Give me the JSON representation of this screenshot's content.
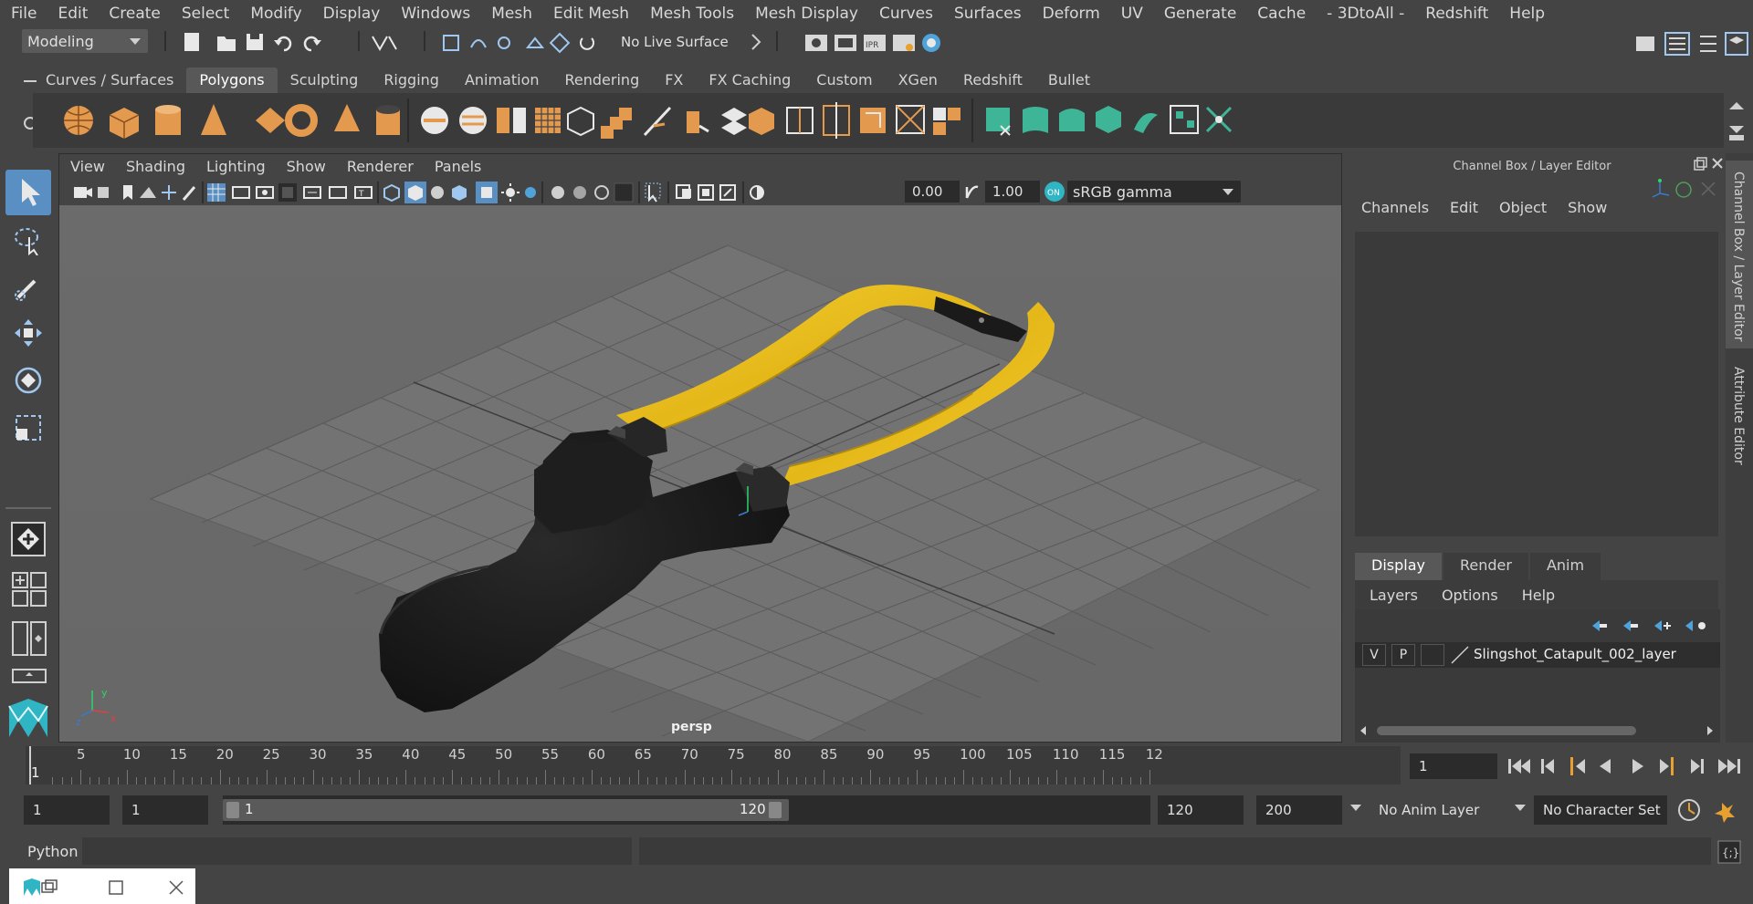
{
  "menubar": {
    "items": [
      "File",
      "Edit",
      "Create",
      "Select",
      "Modify",
      "Display",
      "Windows",
      "Mesh",
      "Edit Mesh",
      "Mesh Tools",
      "Mesh Display",
      "Curves",
      "Surfaces",
      "Deform",
      "UV",
      "Generate",
      "Cache",
      "- 3DtoAll -",
      "Redshift",
      "Help"
    ]
  },
  "statusline": {
    "mode": "Modeling",
    "live_surface": "No Live Surface"
  },
  "shelf": {
    "tabs": [
      "Curves / Surfaces",
      "Polygons",
      "Sculpting",
      "Rigging",
      "Animation",
      "Rendering",
      "FX",
      "FX Caching",
      "Custom",
      "XGen",
      "Redshift",
      "Bullet"
    ],
    "active_tab": "Polygons"
  },
  "viewport": {
    "menu": [
      "View",
      "Shading",
      "Lighting",
      "Show",
      "Renderer",
      "Panels"
    ],
    "exposure": "0.00",
    "gamma": "1.00",
    "colorspace": "sRGB gamma",
    "camera_label": "persp",
    "axis_x": "x",
    "axis_y": "y",
    "axis_z": "z"
  },
  "channelbox": {
    "title": "Channel Box / Layer Editor",
    "menu": [
      "Channels",
      "Edit",
      "Object",
      "Show"
    ],
    "layer_tabs": [
      "Display",
      "Render",
      "Anim"
    ],
    "layer_menu": [
      "Layers",
      "Options",
      "Help"
    ],
    "layer": {
      "v": "V",
      "p": "P",
      "name": "Slingshot_Catapult_002_layer"
    }
  },
  "sidetabs": {
    "channel_box": "Channel Box / Layer Editor",
    "attribute_editor": "Attribute Editor"
  },
  "timeline": {
    "start_marker": "1",
    "ticks": [
      "5",
      "10",
      "15",
      "20",
      "25",
      "30",
      "35",
      "40",
      "45",
      "50",
      "55",
      "60",
      "65",
      "70",
      "75",
      "80",
      "85",
      "90",
      "95",
      "100",
      "105",
      "110",
      "115",
      "12"
    ],
    "current_frame": "1"
  },
  "range": {
    "start": "1",
    "playback_start": "1",
    "slider_start": "1",
    "slider_end": "120",
    "playback_end": "120",
    "end": "200",
    "anim_layer": "No Anim Layer",
    "character_set": "No Character Set"
  },
  "cmdline": {
    "language": "Python"
  },
  "colors": {
    "accent_active": "#5a8fc4",
    "strap": "#e8c020",
    "body_black": "#1c1c1c",
    "shelf_orange": "#e39a4e",
    "shelf_teal": "#3fb597"
  }
}
